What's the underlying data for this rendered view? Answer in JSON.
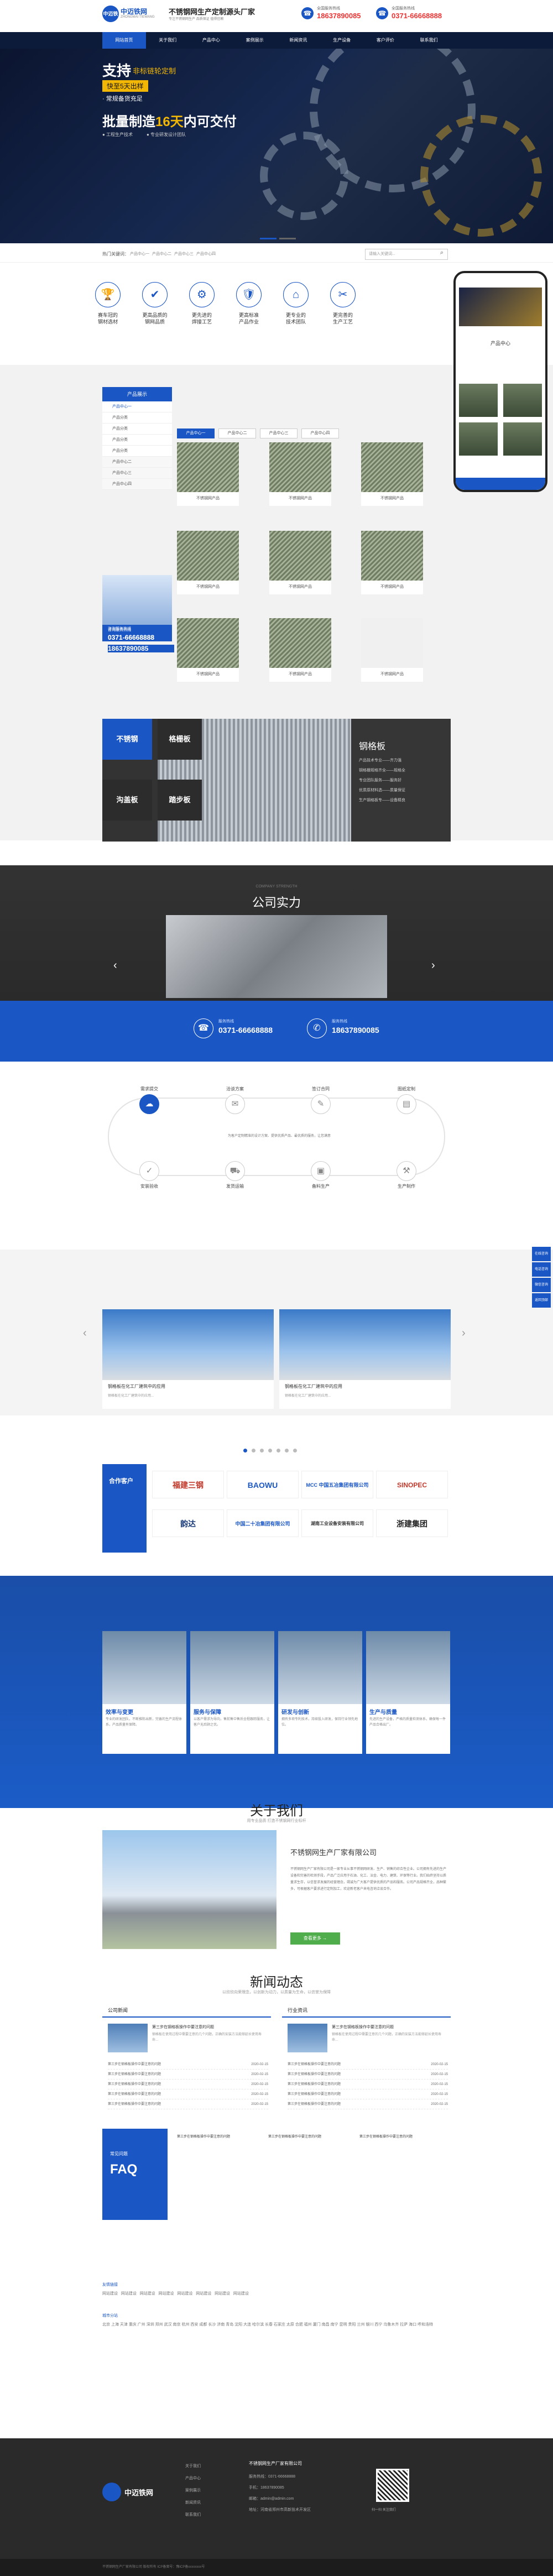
{
  "header": {
    "logo_text": "中迈铁网",
    "logo_sub": "ZHONGMAI TIEWANG",
    "slogan": "不锈钢网生产定制源头厂家",
    "slogan_sub": "专注不锈钢网生产 品质保证 值得信赖",
    "hotline1_label": "全国服务热线",
    "hotline1": "18637890085",
    "hotline2_label": "全国服务热线",
    "hotline2": "0371-66668888"
  },
  "nav": [
    "网站首页",
    "关于我们",
    "产品中心",
    "案例展示",
    "新闻资讯",
    "生产设备",
    "客户评价",
    "联系我们"
  ],
  "banner": {
    "line1": "支持",
    "line1b": "非标链轮定制",
    "line2": "快至5天出样",
    "line3": "· 常规备货充足",
    "line4a": "批量制造",
    "line4b": "16天",
    "line4c": "内可交付",
    "tag1": "● 工程生产技术",
    "tag2": "● 专业研发设计团队"
  },
  "strip": {
    "hot_label": "热门关键词：",
    "keys": [
      "产品中心一",
      "产品中心二",
      "产品中心三",
      "产品中心四"
    ],
    "search_placeholder": "请输入关键词..."
  },
  "features": [
    {
      "icon": "🏆",
      "t1": "赛车冠的",
      "t2": "钢材选材"
    },
    {
      "icon": "✔",
      "t1": "更高品质的",
      "t2": "钢网品质"
    },
    {
      "icon": "⚙",
      "t1": "更先进的",
      "t2": "焊接工艺"
    },
    {
      "icon": "🛡",
      "t1": "更高标准",
      "t2": "产品作业"
    },
    {
      "icon": "⌂",
      "t1": "更专业的",
      "t2": "技术团队"
    },
    {
      "icon": "✂",
      "t1": "更完善的",
      "t2": "生产工艺"
    }
  ],
  "phone": {
    "title": "产品中心",
    "banner": "产品展示 网站"
  },
  "products": {
    "side_title": "产品展示",
    "side_items": [
      "产品中心一",
      "产品分类",
      "产品分类",
      "产品分类",
      "产品分类",
      "产品中心二",
      "产品中心三",
      "产品中心四"
    ],
    "tabs": [
      "产品中心一",
      "产品中心二",
      "产品中心三",
      "产品中心四"
    ],
    "items": [
      "不锈钢网产品",
      "不锈钢网产品",
      "不锈钢网产品",
      "不锈钢网产品",
      "不锈钢网产品",
      "不锈钢网产品",
      "不锈钢网产品",
      "不锈钢网产品",
      "不锈钢网产品"
    ],
    "contact_label": "咨询服务热线",
    "contact_phone1": "0371-66668888",
    "contact_phone2": "18637890085"
  },
  "grating": {
    "blocks": [
      "不锈钢",
      "格栅板",
      "沟盖板",
      "踏步板"
    ],
    "title": "钢格板",
    "list": [
      "产品技术专业——齐力强",
      "钢格栅规格齐全——规格全",
      "专业团队服务——服务好",
      "优质原材料选——质量保证",
      "生产钢格板专——设备精良"
    ]
  },
  "strength": {
    "title": "公司实力",
    "en": "COMPANY STRENGTH"
  },
  "bluebar": {
    "label1": "服务热线",
    "num1": "0371-66668888",
    "label2": "服务热线",
    "num2": "18637890085"
  },
  "process": {
    "steps": [
      "需求提交",
      "洽谈方案",
      "签订合同",
      "图纸定制",
      "安装验收",
      "发货运输",
      "备料生产",
      "生产制作"
    ],
    "desc": "为客户定制精准的设计方案、提供优质产品、最优质的服务，让您满意"
  },
  "cases": {
    "items": [
      {
        "t": "钢格板在化工厂建筑中的应用",
        "d": "钢格板在化工厂建筑中的应用..."
      },
      {
        "t": "钢格板在化工厂建筑中的应用",
        "d": "钢格板在化工厂建筑中的应用..."
      }
    ],
    "more": "MORE"
  },
  "partners": {
    "head": "合作客户",
    "logos": [
      "福建三钢",
      "BAOWU",
      "MCC 中国五冶集团有限公司",
      "SINOPEC",
      "韵达",
      "中国二十冶集团有限公司",
      "湖南工业设备安装有限公司",
      "浙建集团"
    ]
  },
  "advantage": [
    {
      "t": "效率与变更",
      "d": "专业的研发团队，不断推陈出新，完善的生产流程体系，产品质量有保障。"
    },
    {
      "t": "服务与保障",
      "d": "以客户需求为导向，售前售中售后全程跟踪服务，让客户无后顾之忧。"
    },
    {
      "t": "研发与创新",
      "d": "拥有多项专利技术，持续投入研发，保持行业领先地位。"
    },
    {
      "t": "生产与质量",
      "d": "先进的生产设备，严格的质量检测体系，确保每一件产品合格出厂。"
    }
  ],
  "about": {
    "title": "关于我们",
    "sub": "用专业品质 打造不锈钢网行业标杆",
    "company": "不锈钢网生产厂家有限公司",
    "text": "不锈钢网生产厂家有限公司是一家专业从事不锈钢网研发、生产、销售的综合性企业。公司拥有先进的生产设备和完善的检测手段，产品广泛应用于石油、化工、冶金、电力、建筑、环保等行业。我们始终坚持以质量求生存，以信誉求发展的经营理念，竭诚为广大客户提供优质的产品和服务。公司产品规格齐全，品种繁多，可根据客户要求进行定制加工，欢迎新老客户来电咨询洽谈合作。",
    "btn": "查看更多 →"
  },
  "news": {
    "title": "新闻动态",
    "sub": "以欣欣向荣理念，以创新为动力，以质量为生命，以信誉为保障",
    "col1": "公司新闻",
    "col2": "行业资讯",
    "top_t": "第三步在钢格板操作中要注意的问题",
    "top_d": "钢格板在使用过程中需要注意的几个问题，正确的安装方法能够延长使用寿命...",
    "rows": [
      "第三步在钢格板操作中要注意的问题",
      "第三步在钢格板操作中要注意的问题",
      "第三步在钢格板操作中要注意的问题",
      "第三步在钢格板操作中要注意的问题",
      "第三步在钢格板操作中要注意的问题"
    ],
    "dates": [
      "2020-02-15",
      "2020-02-15",
      "2020-02-15",
      "2020-02-15",
      "2020-02-15"
    ],
    "faq_label": "常见问题",
    "faq": "FAQ",
    "faq_items": [
      "第三步在钢格板操作中要注意的问题",
      "第三步在钢格板操作中要注意的问题",
      "第三步在钢格板操作中要注意的问题"
    ]
  },
  "links": {
    "label1": "友情链接",
    "items1": [
      "网站建设",
      "网站建设",
      "网站建设",
      "网站建设",
      "网站建设",
      "网站建设",
      "网站建设",
      "网站建设"
    ],
    "label2": "城市分站",
    "cities": "北京 上海 天津 重庆 广州 深圳 郑州 武汉 南京 杭州 西安 成都 长沙 济南 青岛 沈阳 大连 哈尔滨 长春 石家庄 太原 合肥 福州 厦门 南昌 南宁 昆明 贵阳 兰州 银川 西宁 乌鲁木齐 拉萨 海口 呼和浩特"
  },
  "footer": {
    "logo": "中迈铁网",
    "nav": [
      "关于我们",
      "产品中心",
      "案例展示",
      "新闻资讯",
      "联系我们"
    ],
    "company": "不锈钢网生产厂家有限公司",
    "phone": "服务热线：0371-66668888",
    "mobile": "手机：18637890085",
    "email": "邮箱：admin@admin.com",
    "addr": "地址：河南省郑州市高新技术开发区",
    "qr_label": "扫一扫 关注我们",
    "copyright": "不锈钢网生产厂家有限公司 版权所有 ICP备案号：豫ICP备xxxxxxxx号"
  },
  "float": [
    "在线咨询",
    "电话咨询",
    "微信咨询",
    "返回顶部"
  ]
}
